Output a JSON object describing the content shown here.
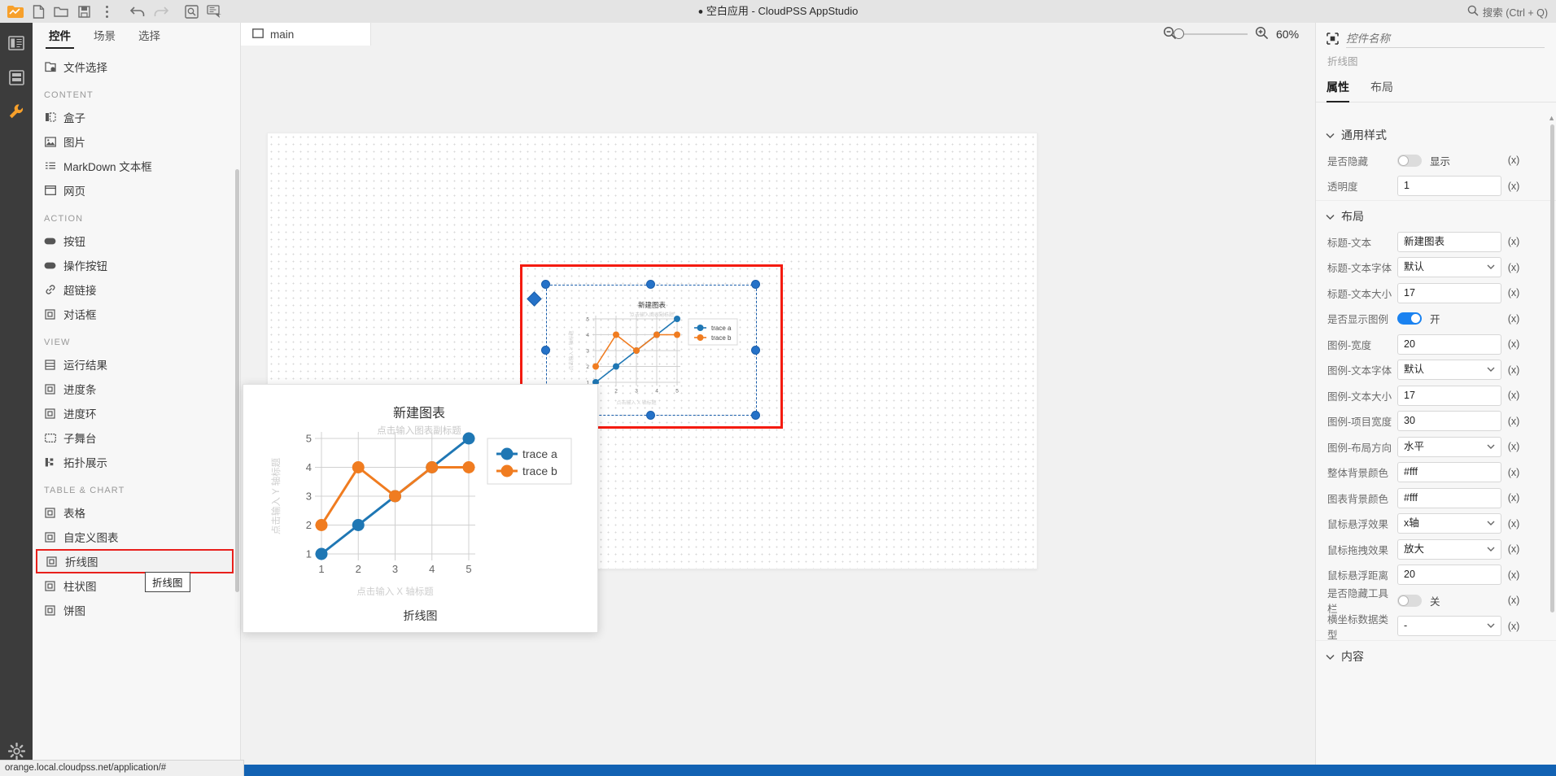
{
  "titlebar": {
    "title": "空白应用 - CloudPSS AppStudio",
    "status_dot": "●",
    "search_placeholder": "搜索 (Ctrl + Q)",
    "tools": [
      {
        "name": "app-logo-icon",
        "label": "CloudPSS"
      },
      {
        "name": "new-file-icon",
        "label": "新建"
      },
      {
        "name": "open-folder-icon",
        "label": "打开"
      },
      {
        "name": "save-icon",
        "label": "保存"
      },
      {
        "name": "more-vertical-icon",
        "label": "更多"
      },
      {
        "name": "undo-icon",
        "label": "撤销"
      },
      {
        "name": "redo-icon",
        "label": "重做"
      },
      {
        "name": "preview-icon",
        "label": "预览"
      },
      {
        "name": "publish-icon",
        "label": "发布"
      }
    ]
  },
  "rail": {
    "items": [
      {
        "name": "layout-icon",
        "label": "布局"
      },
      {
        "name": "layers-icon",
        "label": "图层"
      },
      {
        "name": "tools-icon",
        "label": "工具"
      }
    ],
    "settings": {
      "name": "gear-icon",
      "label": "设置"
    }
  },
  "left_panel": {
    "tabs": [
      {
        "label": "控件",
        "active": true
      },
      {
        "label": "场景",
        "active": false
      },
      {
        "label": "选择",
        "active": false
      }
    ],
    "top_item": {
      "label": "文件选择",
      "icon": "file-select-icon"
    },
    "groups": [
      {
        "title": "CONTENT",
        "items": [
          {
            "label": "盒子",
            "icon": "box-icon"
          },
          {
            "label": "图片",
            "icon": "image-icon"
          },
          {
            "label": "MarkDown 文本框",
            "icon": "markdown-icon"
          },
          {
            "label": "网页",
            "icon": "webpage-icon"
          }
        ]
      },
      {
        "title": "ACTION",
        "items": [
          {
            "label": "按钮",
            "icon": "button-icon"
          },
          {
            "label": "操作按钮",
            "icon": "action-button-icon"
          },
          {
            "label": "超链接",
            "icon": "link-icon"
          },
          {
            "label": "对话框",
            "icon": "dialog-icon"
          }
        ]
      },
      {
        "title": "VIEW",
        "items": [
          {
            "label": "运行结果",
            "icon": "result-icon"
          },
          {
            "label": "进度条",
            "icon": "progress-bar-icon"
          },
          {
            "label": "进度环",
            "icon": "progress-ring-icon"
          },
          {
            "label": "子舞台",
            "icon": "substage-icon"
          },
          {
            "label": "拓扑展示",
            "icon": "topology-icon"
          }
        ]
      },
      {
        "title": "TABLE & CHART",
        "items": [
          {
            "label": "表格",
            "icon": "table-icon"
          },
          {
            "label": "自定义图表",
            "icon": "custom-chart-icon"
          },
          {
            "label": "折线图",
            "icon": "line-chart-icon",
            "selected": true
          },
          {
            "label": "柱状图",
            "icon": "bar-chart-icon"
          },
          {
            "label": "饼图",
            "icon": "pie-chart-icon"
          }
        ]
      }
    ],
    "hover_tooltip": "折线图"
  },
  "statusbar": {
    "url": "orange.local.cloudpss.net/application/#"
  },
  "center": {
    "tab": {
      "label": "main",
      "icon": "window-icon"
    },
    "zoom": {
      "zoom_out_icon": "zoom-out-icon",
      "zoom_in_icon": "zoom-in-icon",
      "percent": "60%"
    }
  },
  "preview_popup": {
    "caption": "折线图"
  },
  "chart_data": {
    "type": "line",
    "title": "新建图表",
    "subtitle": "点击输入图表副标题",
    "xlabel": "点击输入 X 轴标题",
    "ylabel": "点击输入 Y 轴标题",
    "x": [
      1,
      2,
      3,
      4,
      5
    ],
    "xticklabels": [
      "1",
      "2",
      "3",
      "4",
      "5"
    ],
    "yticklabels": [
      "1",
      "2",
      "3",
      "4",
      "5"
    ],
    "ylim": [
      1,
      5
    ],
    "xlim": [
      1,
      5
    ],
    "grid": true,
    "legend_position": "right",
    "series": [
      {
        "name": "trace a",
        "color": "#1f77b4",
        "values": [
          1,
          2,
          3,
          4,
          5
        ]
      },
      {
        "name": "trace b",
        "color": "#f07c20",
        "values": [
          2,
          4,
          3,
          4,
          4
        ]
      }
    ]
  },
  "right_panel": {
    "name_placeholder": "控件名称",
    "widget_type": "折线图",
    "widget_icon": "widget-icon",
    "tabs": [
      {
        "label": "属性",
        "active": true
      },
      {
        "label": "布局",
        "active": false
      }
    ],
    "sections": [
      {
        "title": "通用样式",
        "rows": [
          {
            "label": "是否隐藏",
            "type": "toggle",
            "on": false,
            "value": "显示",
            "expr": "(x)"
          },
          {
            "label": "透明度",
            "type": "input",
            "value": "1",
            "expr": "(x)"
          }
        ]
      },
      {
        "title": "布局",
        "rows": [
          {
            "label": "标题-文本",
            "type": "input",
            "value": "新建图表",
            "expr": "(x)"
          },
          {
            "label": "标题-文本字体",
            "type": "select",
            "value": "默认",
            "expr": "(x)"
          },
          {
            "label": "标题-文本大小",
            "type": "input",
            "value": "17",
            "expr": "(x)"
          },
          {
            "label": "是否显示图例",
            "type": "toggle",
            "on": true,
            "value": "开",
            "expr": "(x)"
          },
          {
            "label": "图例-宽度",
            "type": "input",
            "value": "20",
            "expr": "(x)"
          },
          {
            "label": "图例-文本字体",
            "type": "select",
            "value": "默认",
            "expr": "(x)"
          },
          {
            "label": "图例-文本大小",
            "type": "input",
            "value": "17",
            "expr": "(x)"
          },
          {
            "label": "图例-项目宽度",
            "type": "input",
            "value": "30",
            "expr": "(x)"
          },
          {
            "label": "图例-布局方向",
            "type": "select",
            "value": "水平",
            "expr": "(x)"
          },
          {
            "label": "整体背景颜色",
            "type": "input",
            "value": "#fff",
            "expr": "(x)"
          },
          {
            "label": "图表背景颜色",
            "type": "input",
            "value": "#fff",
            "expr": "(x)"
          },
          {
            "label": "鼠标悬浮效果",
            "type": "select",
            "value": "x轴",
            "expr": "(x)"
          },
          {
            "label": "鼠标拖拽效果",
            "type": "select",
            "value": "放大",
            "expr": "(x)"
          },
          {
            "label": "鼠标悬浮距离",
            "type": "input",
            "value": "20",
            "expr": "(x)"
          },
          {
            "label": "是否隐藏工具栏",
            "type": "toggle",
            "on": false,
            "value": "关",
            "expr": "(x)"
          },
          {
            "label": "横坐标数据类型",
            "type": "select",
            "value": "-",
            "expr": "(x)"
          }
        ]
      },
      {
        "title": "内容",
        "rows": []
      }
    ]
  },
  "colors": {
    "accent_blue": "#1a82f0",
    "selection_red": "#f41b10",
    "series_a": "#1f77b4",
    "series_b": "#f07c20"
  }
}
